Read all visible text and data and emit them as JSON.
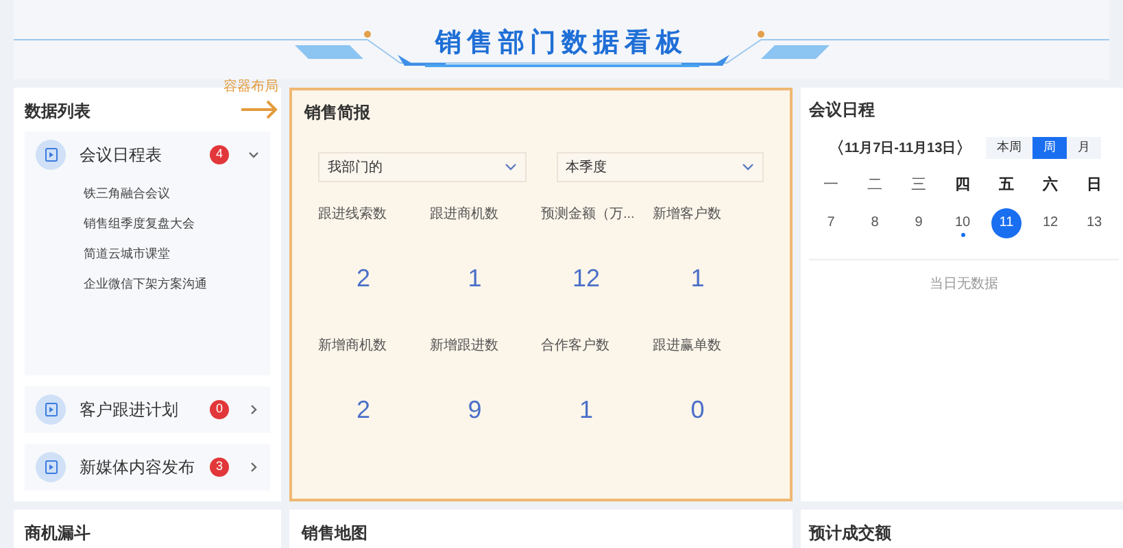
{
  "header": {
    "title": "销售部门数据看板"
  },
  "annotation": {
    "label": "容器布局"
  },
  "data_list": {
    "title": "数据列表",
    "groups": [
      {
        "label": "会议日程表",
        "count": "4",
        "expanded": true,
        "children": [
          "铁三角融合会议",
          "销售组季度复盘大会",
          "简道云城市课堂",
          "企业微信下架方案沟通"
        ]
      },
      {
        "label": "客户跟进计划",
        "count": "0",
        "expanded": false
      },
      {
        "label": "新媒体内容发布",
        "count": "3",
        "expanded": false
      }
    ]
  },
  "sales_brief": {
    "title": "销售简报",
    "filters": [
      {
        "value": "我部门的"
      },
      {
        "value": "本季度"
      }
    ],
    "metrics": [
      {
        "label": "跟进线索数",
        "value": "2"
      },
      {
        "label": "跟进商机数",
        "value": "1"
      },
      {
        "label": "预测金额（万...",
        "value": "12"
      },
      {
        "label": "新增客户数",
        "value": "1"
      },
      {
        "label": "新增商机数",
        "value": "2"
      },
      {
        "label": "新增跟进数",
        "value": "9"
      },
      {
        "label": "合作客户数",
        "value": "1"
      },
      {
        "label": "跟进赢单数",
        "value": "0"
      }
    ]
  },
  "meeting_schedule": {
    "title": "会议日程",
    "range": "11月7日-11月13日",
    "prev": "〈",
    "next": "〉",
    "views": [
      {
        "label": "本周",
        "selected": false
      },
      {
        "label": "周",
        "selected": true
      },
      {
        "label": "月",
        "selected": false
      }
    ],
    "days": [
      {
        "weekday": "一",
        "date": "7",
        "selected": false,
        "has_event": false
      },
      {
        "weekday": "二",
        "date": "8",
        "selected": false,
        "has_event": false
      },
      {
        "weekday": "三",
        "date": "9",
        "selected": false,
        "has_event": false
      },
      {
        "weekday": "四",
        "date": "10",
        "selected": false,
        "has_event": true
      },
      {
        "weekday": "五",
        "date": "11",
        "selected": true,
        "has_event": false
      },
      {
        "weekday": "六",
        "date": "12",
        "selected": false,
        "has_event": false
      },
      {
        "weekday": "日",
        "date": "13",
        "selected": false,
        "has_event": false
      }
    ],
    "empty": "当日无数据"
  },
  "bottom_panels": [
    {
      "title": "商机漏斗"
    },
    {
      "title": "销售地图"
    },
    {
      "title": "预计成交额"
    }
  ]
}
